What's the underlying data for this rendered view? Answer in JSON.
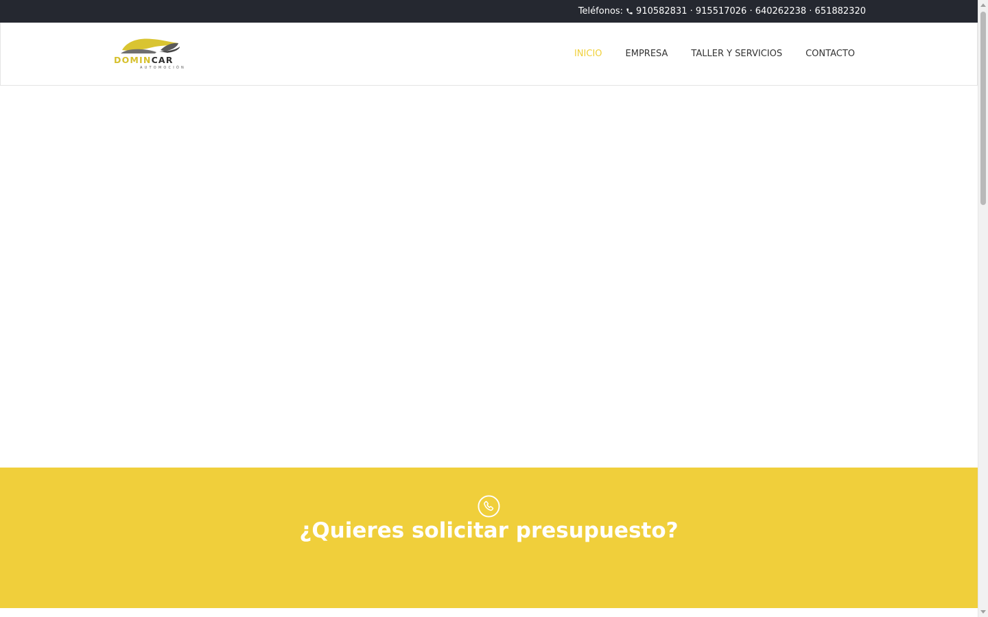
{
  "topbar": {
    "label": "Teléfonos:",
    "phones": "910582831 · 915517026 · 640262238 · 651882320",
    "icon": "phone-icon"
  },
  "logo": {
    "name_part1": "DOMIN",
    "name_part2": "CAR",
    "subtitle": "AUTOMOCIÓN"
  },
  "nav": {
    "items": [
      {
        "label": "INICIO",
        "active": true
      },
      {
        "label": "EMPRESA",
        "active": false
      },
      {
        "label": "TALLER Y SERVICIOS",
        "active": false
      },
      {
        "label": "CONTACTO",
        "active": false
      }
    ]
  },
  "cta": {
    "icon": "phone-circle-icon",
    "title": "¿Quieres solicitar presupuesto?"
  },
  "colors": {
    "topbar_bg": "#252830",
    "accent_yellow": "#f0cf3b",
    "nav_active": "#f0d03a",
    "text_dark": "#333333"
  }
}
